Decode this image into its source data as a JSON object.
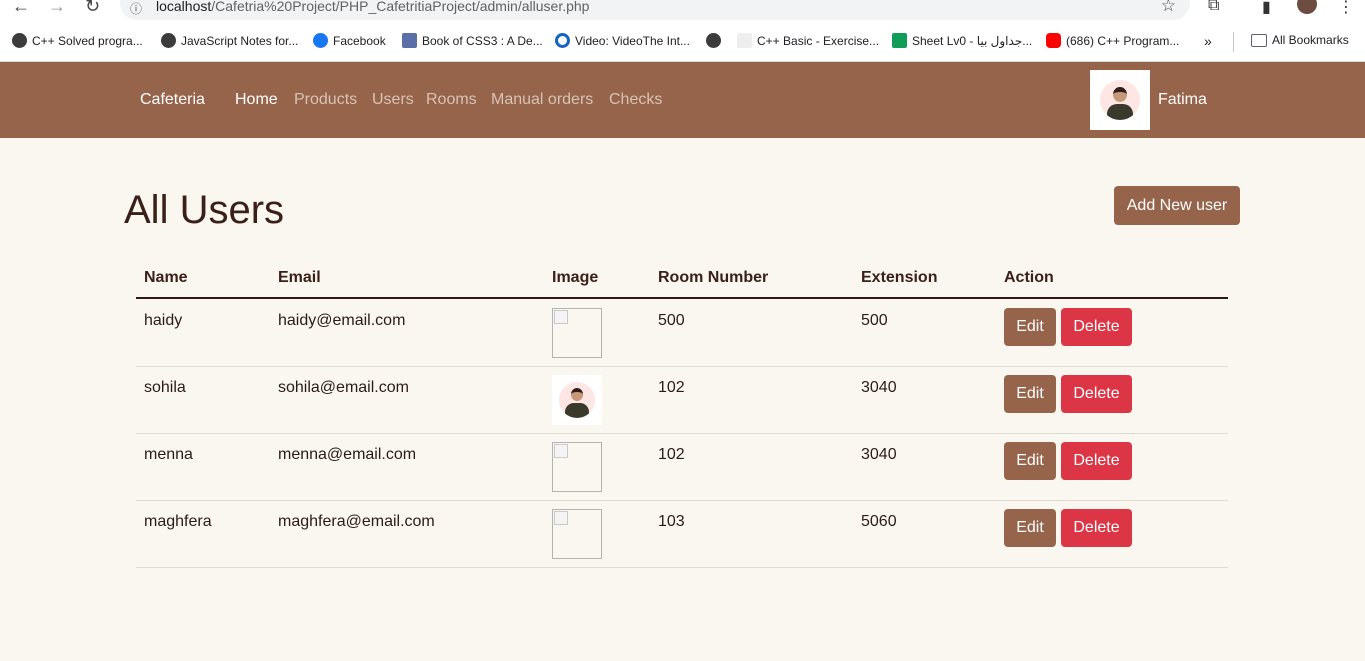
{
  "browser": {
    "url_host": "localhost",
    "url_path": "/Cafetria%20Project/PHP_CafetritiaProject/admin/alluser.php",
    "bookmarks": [
      {
        "label": "C++ Solved progra...",
        "icon": "globe-icon"
      },
      {
        "label": "JavaScript Notes for...",
        "icon": "globe-icon"
      },
      {
        "label": "Facebook",
        "icon": "facebook-icon"
      },
      {
        "label": "Book of CSS3 : A De...",
        "icon": "book-icon"
      },
      {
        "label": "Video: VideoThe Int...",
        "icon": "c-logo-icon"
      },
      {
        "label": "",
        "icon": "globe-icon"
      },
      {
        "label": "C++ Basic - Exercise...",
        "icon": "w3r-icon"
      },
      {
        "label": "Sheet Lv0 - جداول بيا...",
        "icon": "sheets-icon"
      },
      {
        "label": "(686) C++ Program...",
        "icon": "youtube-icon"
      }
    ],
    "all_bookmarks": "All Bookmarks"
  },
  "navbar": {
    "brand": "Cafeteria",
    "links": [
      "Home",
      "Products",
      "Users",
      "Rooms",
      "Manual orders",
      "Checks"
    ],
    "active_link": "Home",
    "user_name": "Fatima",
    "accent_color": "#95644a"
  },
  "main": {
    "title": "All Users",
    "add_button": "Add New user"
  },
  "table": {
    "headers": [
      "Name",
      "Email",
      "Image",
      "Room Number",
      "Extension",
      "Action"
    ],
    "rows": [
      {
        "name": "haidy",
        "email": "haidy@email.com",
        "image": "broken",
        "room": "500",
        "ext": "500"
      },
      {
        "name": "sohila",
        "email": "sohila@email.com",
        "image": "avatar",
        "room": "102",
        "ext": "3040"
      },
      {
        "name": "menna",
        "email": "menna@email.com",
        "image": "broken",
        "room": "102",
        "ext": "3040"
      },
      {
        "name": "maghfera",
        "email": "maghfera@email.com",
        "image": "broken",
        "room": "103",
        "ext": "5060"
      }
    ],
    "edit_label": "Edit",
    "delete_label": "Delete",
    "delete_color": "#dc3545"
  }
}
